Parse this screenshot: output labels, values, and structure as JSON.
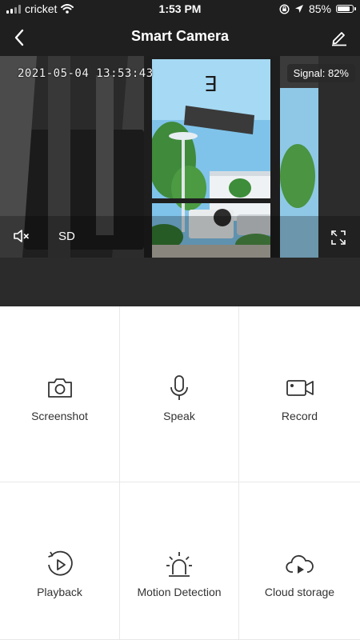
{
  "status_bar": {
    "carrier": "cricket",
    "time": "1:53 PM",
    "battery": "85%"
  },
  "header": {
    "title": "Smart Camera",
    "back_icon": "chevron-left-icon",
    "edit_icon": "pencil-icon"
  },
  "video": {
    "timestamp": "2021-05-04 13:53:43",
    "signal": "Signal: 82%",
    "quality": "SD",
    "mute_icon": "speaker-mute-icon",
    "fullscreen_icon": "fullscreen-icon"
  },
  "actions": [
    {
      "label": "Screenshot",
      "icon": "camera-icon"
    },
    {
      "label": "Speak",
      "icon": "microphone-icon"
    },
    {
      "label": "Record",
      "icon": "video-camera-icon"
    },
    {
      "label": "Playback",
      "icon": "playback-icon"
    },
    {
      "label": "Motion Detection",
      "icon": "alarm-light-icon"
    },
    {
      "label": "Cloud storage",
      "icon": "cloud-play-icon"
    }
  ],
  "colors": {
    "header_bg": "#1f1f1f",
    "dark_band": "#2b2b2b",
    "icon_stroke": "#333333"
  }
}
